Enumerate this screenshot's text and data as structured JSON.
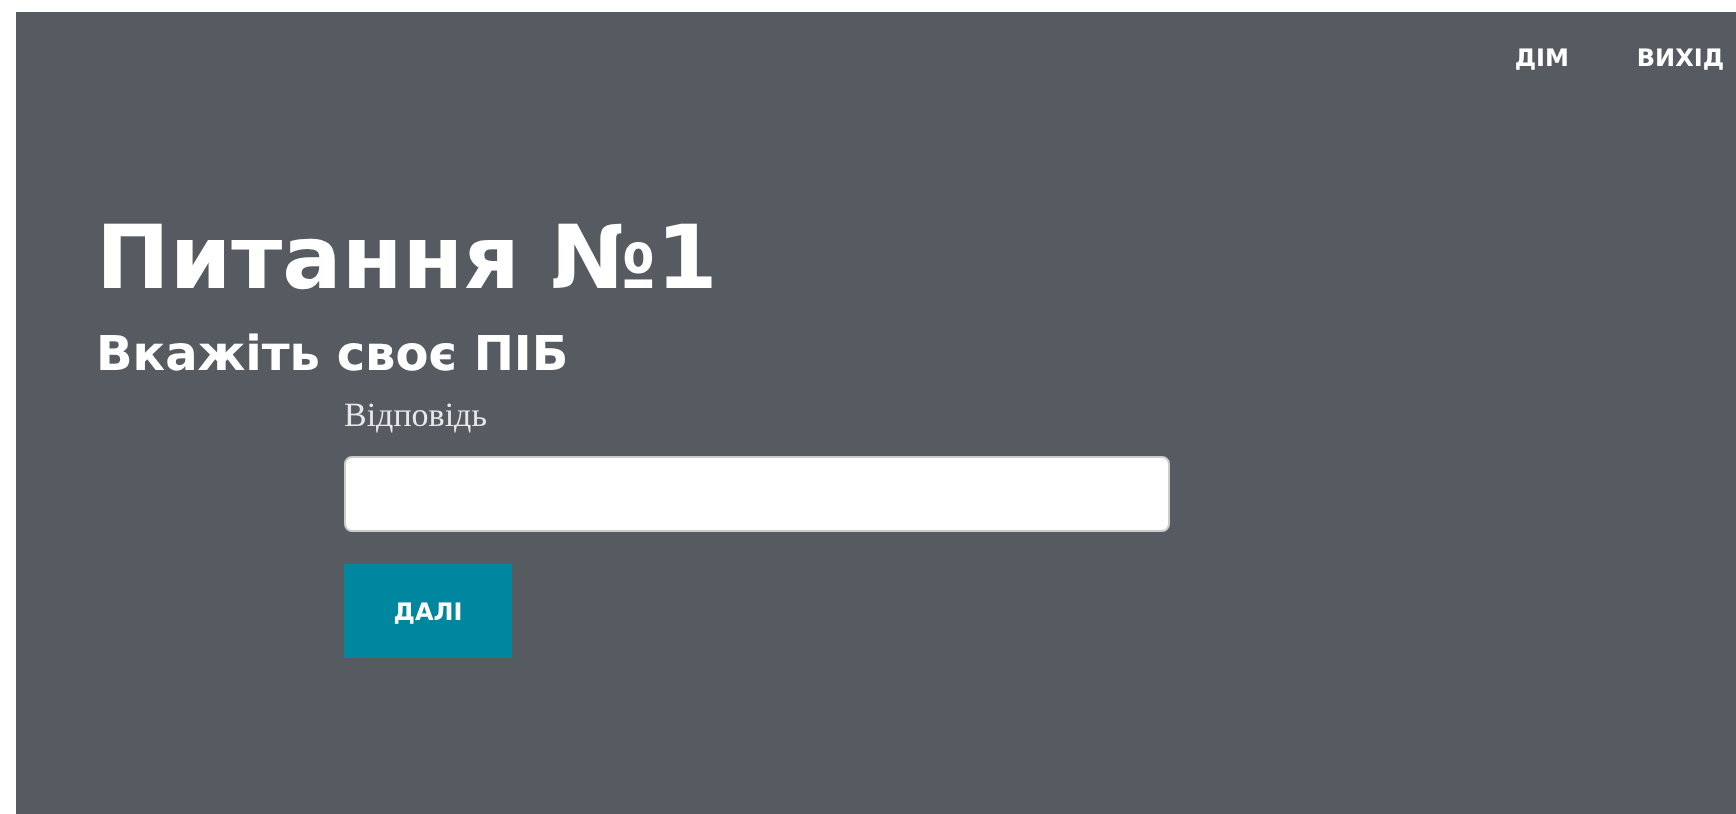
{
  "nav": [
    {
      "label": "ДІМ"
    },
    {
      "label": "ВИХІД"
    }
  ],
  "title": "Питання №1",
  "question": "Вкажіть своє ПІБ",
  "answer": {
    "label": "Відповідь"
  },
  "next_button": "ДАЛІ"
}
